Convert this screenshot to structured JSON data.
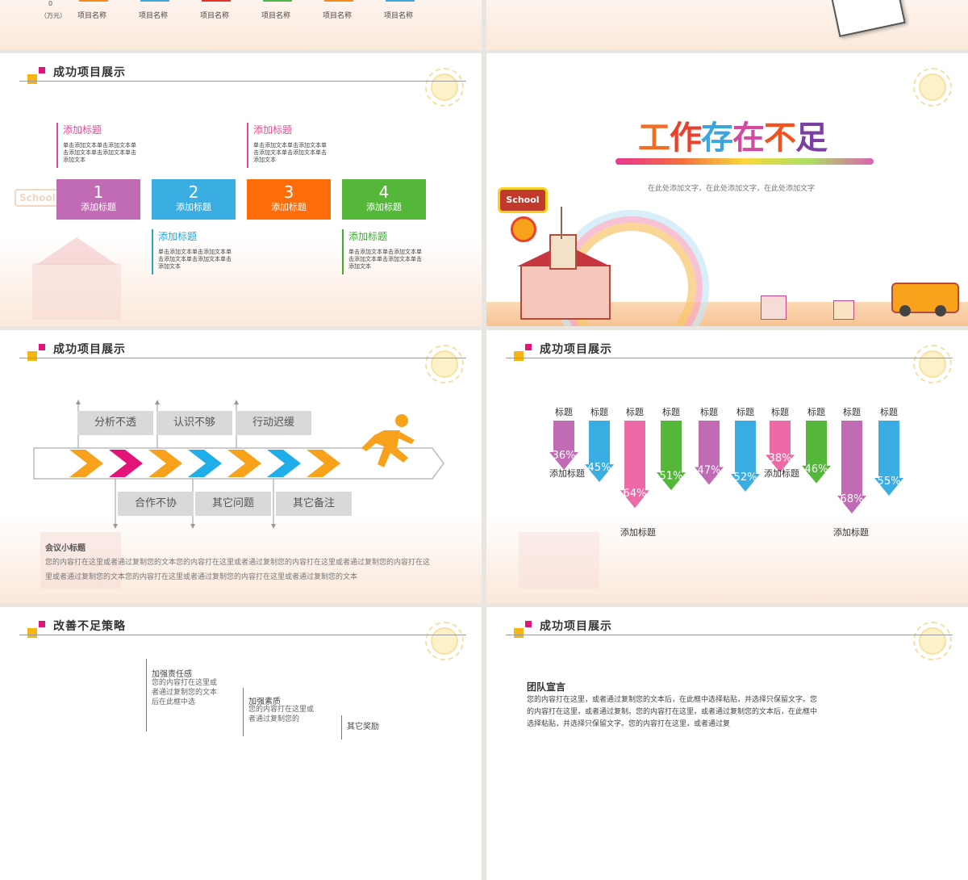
{
  "slide0": {
    "axis_zero": "0",
    "axis_unit": "（万元）",
    "bars": [
      {
        "label": "项目名称",
        "color": "#f58b1e"
      },
      {
        "label": "项目名称",
        "color": "#3fa9e0"
      },
      {
        "label": "项目名称",
        "color": "#e8322b"
      },
      {
        "label": "项目名称",
        "color": "#4cb84a"
      },
      {
        "label": "项目名称",
        "color": "#f58b1e"
      },
      {
        "label": "项目名称",
        "color": "#3fa9e0"
      }
    ]
  },
  "slide2": {
    "title": "成功项目展示",
    "ghost_school": "School",
    "items": [
      {
        "num": "1",
        "label": "添加标题",
        "color": "#c06bb4",
        "cap": "添加标题",
        "cap_color": "#d94d9b",
        "desc": "单击添加文本单击添加文本单击添加文本单击添加文本单击添加文本"
      },
      {
        "num": "2",
        "label": "添加标题",
        "color": "#3aaee3",
        "cap": "添加标题",
        "cap_color": "#2fa3d8",
        "desc": "单击添加文本单击添加文本单击添加文本单击添加文本单击添加文本"
      },
      {
        "num": "3",
        "label": "添加标题",
        "color": "#ff6d0a",
        "cap": "添加标题",
        "cap_color": "#e94d8f",
        "desc": "单击添加文本单击添加文本单击添加文本单击添加文本单击添加文本"
      },
      {
        "num": "4",
        "label": "添加标题",
        "color": "#55b73a",
        "cap": "添加标题",
        "cap_color": "#3eaa37",
        "desc": "单击添加文本单击添加文本单击添加文本单击添加文本单击添加文本"
      }
    ]
  },
  "slide3": {
    "big_title_chars": [
      {
        "ch": "工",
        "color": "#f26c22"
      },
      {
        "ch": "作",
        "color": "#e8422c"
      },
      {
        "ch": "存",
        "color": "#3aa6dd"
      },
      {
        "ch": "在",
        "color": "#d44aa0"
      },
      {
        "ch": "不",
        "color": "#f0531f"
      },
      {
        "ch": "足",
        "color": "#7a3fa0"
      }
    ],
    "subtitle": "在此处添加文字，在此处添加文字，在此处添加文字",
    "school_sign": "School"
  },
  "slide4": {
    "title": "成功项目展示",
    "top_labels": [
      "分析不透",
      "认识不够",
      "行动迟缓"
    ],
    "bottom_labels": [
      "合作不协",
      "其它问题",
      "其它备注"
    ],
    "subtitle": "会议小标题",
    "body": "您的内容打在这里或者通过复制您的文本您的内容打在这里或者通过复制您的内容打在这里或者通过复制您的内容打在这里或者通过复制您的文本您的内容打在这里或者通过复制您的内容打在这里或者通过复制您的文本",
    "chevron_colors": [
      "#f7a21a",
      "#e4137a",
      "#f7a21a",
      "#1faee9",
      "#f7a21a",
      "#1faee9",
      "#f7a21a"
    ],
    "runner_color": "#f7a21a"
  },
  "slide5": {
    "title": "成功项目展示",
    "bars": [
      {
        "label": "标题",
        "pct": "36%",
        "value": 36,
        "color": "#c06bb4"
      },
      {
        "label": "标题",
        "pct": "45%",
        "value": 45,
        "color": "#3aaee3"
      },
      {
        "label": "标题",
        "pct": "64%",
        "value": 64,
        "color": "#ee6aa7"
      },
      {
        "label": "标题",
        "pct": "51%",
        "value": 51,
        "color": "#55b73a"
      },
      {
        "label": "标题",
        "pct": "47%",
        "value": 47,
        "color": "#c06bb4"
      },
      {
        "label": "标题",
        "pct": "52%",
        "value": 52,
        "color": "#3aaee3"
      },
      {
        "label": "标题",
        "pct": "38%",
        "value": 38,
        "color": "#ee6aa7"
      },
      {
        "label": "标题",
        "pct": "46%",
        "value": 46,
        "color": "#55b73a"
      },
      {
        "label": "标题",
        "pct": "68%",
        "value": 68,
        "color": "#c06bb4"
      },
      {
        "label": "标题",
        "pct": "55%",
        "value": 55,
        "color": "#3aaee3"
      }
    ],
    "captions": [
      "添加标题",
      "添加标题",
      "添加标题",
      "添加标题"
    ]
  },
  "slide6": {
    "title": "改善不足策略",
    "item1_title": "加强责任感",
    "item1_desc": "您的内容打在这里或者通过复制您的文本后在此框中选",
    "item2_title": "加强素质",
    "item2_desc": "您的内容打在这里或者通过复制您的",
    "item3_title": "其它奖励"
  },
  "slide7": {
    "title": "成功项目展示",
    "subtitle": "团队宣言",
    "body": "您的内容打在这里，或者通过复制您的文本后，在此框中选择粘贴，并选择只保留文字。您的内容打在这里，或者通过复制。您的内容打在这里，或者通过复制您的文本后，在此框中选择粘贴，并选择只保留文字。您的内容打在这里，或者通过复"
  }
}
